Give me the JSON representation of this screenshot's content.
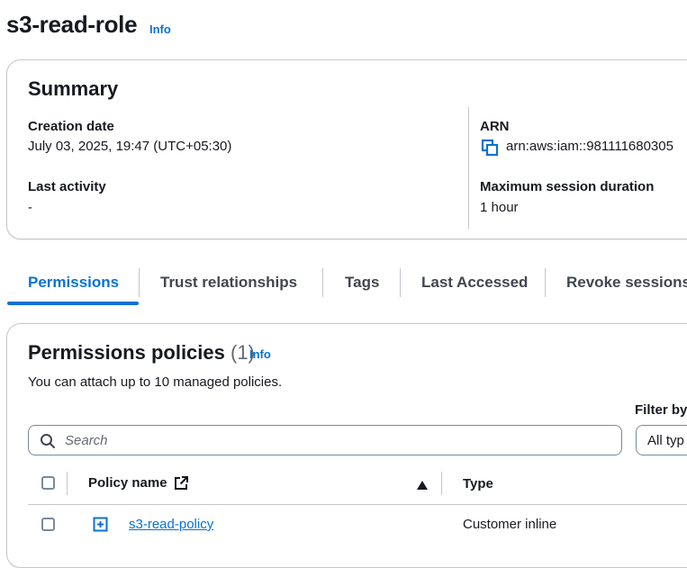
{
  "header": {
    "title": "s3-read-role",
    "info_label": "Info"
  },
  "summary": {
    "title": "Summary",
    "creation_date_label": "Creation date",
    "creation_date_value": "July 03, 2025, 19:47 (UTC+05:30)",
    "last_activity_label": "Last activity",
    "last_activity_value": "-",
    "arn_label": "ARN",
    "arn_value": "arn:aws:iam::981111680305",
    "max_session_label": "Maximum session duration",
    "max_session_value": "1 hour"
  },
  "tabs": [
    {
      "label": "Permissions",
      "active": true
    },
    {
      "label": "Trust relationships",
      "active": false
    },
    {
      "label": "Tags",
      "active": false
    },
    {
      "label": "Last Accessed",
      "active": false
    },
    {
      "label": "Revoke sessions",
      "active": false
    }
  ],
  "policies": {
    "title": "Permissions policies",
    "count": "(1)",
    "info_label": "Info",
    "description": "You can attach up to 10 managed policies.",
    "filter_label": "Filter by",
    "filter_value": "All typ",
    "search_placeholder": "Search",
    "columns": {
      "policy_name": "Policy name",
      "type": "Type"
    },
    "rows": [
      {
        "name": "s3-read-policy",
        "type": "Customer inline"
      }
    ]
  },
  "colors": {
    "accent": "#0972d3",
    "text": "#16191f",
    "border": "#c6c6cd"
  },
  "icons": {
    "copy": "copy-icon",
    "search": "search-icon",
    "external_link": "external-link-icon",
    "sort": "sort-ascending-icon",
    "expand": "expand-icon"
  }
}
